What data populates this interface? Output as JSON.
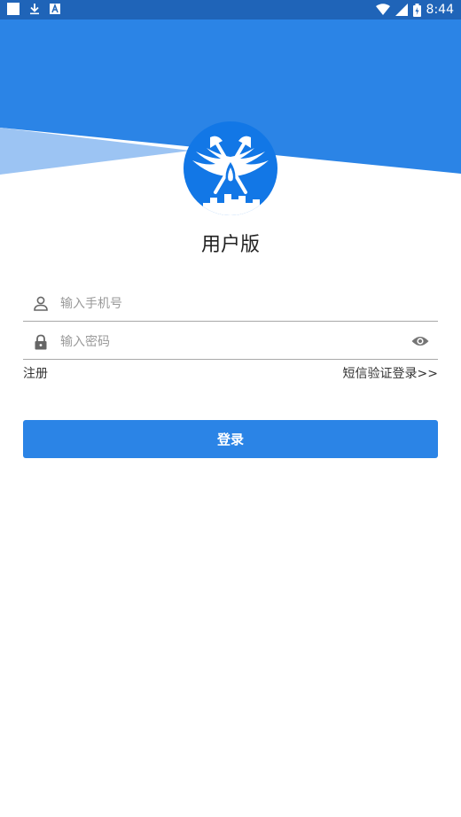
{
  "status_bar": {
    "time": "8:44",
    "icons": [
      "square-notification-icon",
      "download-icon",
      "a-notification-icon",
      "wifi-icon",
      "signal-icon",
      "battery-icon"
    ]
  },
  "app": {
    "title": "用户版"
  },
  "form": {
    "phone": {
      "placeholder": "输入手机号",
      "value": ""
    },
    "password": {
      "placeholder": "输入密码",
      "value": ""
    },
    "register_label": "注册",
    "sms_login_label": "短信验证登录>>",
    "login_label": "登录"
  },
  "colors": {
    "primary": "#2b84e6",
    "status_bar": "#1f64b8",
    "header_light": "#9cc4f3",
    "logo_blue": "#1277e6"
  }
}
